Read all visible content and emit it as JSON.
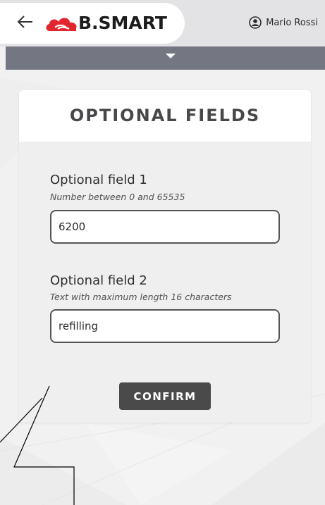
{
  "header": {
    "logo_text": "B.SMART",
    "user_name": "Mario Rossi"
  },
  "card": {
    "title": "OPTIONAL FIELDS",
    "fields": [
      {
        "label": "Optional field 1",
        "hint": "Number between 0 and 65535",
        "value": "6200"
      },
      {
        "label": "Optional field 2",
        "hint": "Text with maximum length 16 characters",
        "value": "refilling"
      }
    ],
    "confirm_label": "CONFIRM"
  },
  "colors": {
    "brand_red": "#e3262e",
    "collapse_bar": "#747682",
    "button": "#4a4a4b"
  },
  "icons": {
    "back": "arrow-left-icon",
    "user": "user-circle-icon",
    "collapse": "caret-down-icon"
  }
}
